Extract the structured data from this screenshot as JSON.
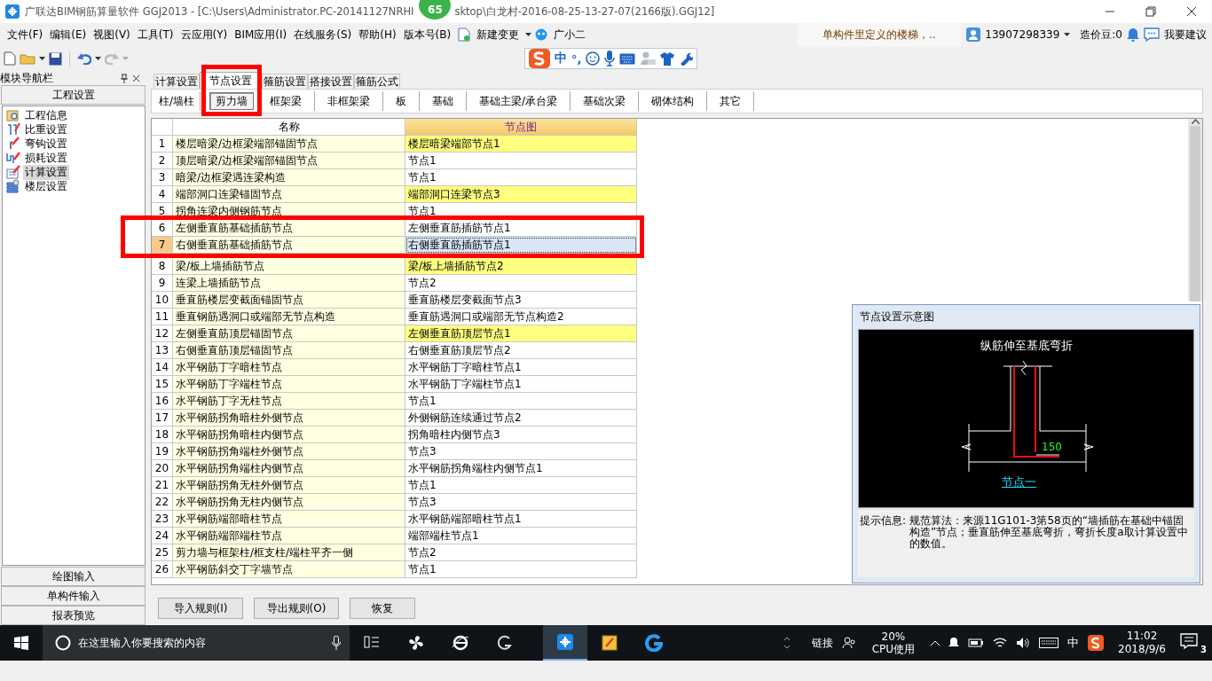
{
  "window": {
    "title_parts": [
      "广联达BIM钢筋算量软件 GGJ2013 - [C:\\Users\\Administrator.PC-20141127NRHI",
      "sktop\\白龙村-2016-08-25-13-27-07(2166版).GGJ12]"
    ],
    "badge": "65"
  },
  "menus": [
    "文件(F)",
    "编辑(E)",
    "视图(V)",
    "工具(T)",
    "云应用(Y)",
    "BIM应用(I)",
    "在线服务(S)",
    "帮助(H)",
    "版本号(B)"
  ],
  "menu_extras": {
    "change": "新建变更",
    "assistant": "广小二"
  },
  "header_right": {
    "notice": "单构件里定义的楼梯，..",
    "account": "13907298339",
    "beans": "造价豆:0",
    "suggest": "我要建议"
  },
  "ime": {
    "lang": "中",
    "punct": "°,"
  },
  "nav": {
    "title": "模块导航栏",
    "section": "工程设置",
    "items": [
      {
        "label": "工程信息",
        "selected": false
      },
      {
        "label": "比重设置",
        "selected": false
      },
      {
        "label": "弯钩设置",
        "selected": false
      },
      {
        "label": "损耗设置",
        "selected": false
      },
      {
        "label": "计算设置",
        "selected": true
      },
      {
        "label": "楼层设置",
        "selected": false
      }
    ],
    "bottom": [
      "绘图输入",
      "单构件输入",
      "报表预览"
    ]
  },
  "tabs": [
    {
      "label": "计算设置",
      "selected": false
    },
    {
      "label": "节点设置",
      "selected": true
    },
    {
      "label": "箍筋设置",
      "selected": false
    },
    {
      "label": "搭接设置",
      "selected": false
    },
    {
      "label": "箍筋公式",
      "selected": false
    }
  ],
  "subtabs": [
    {
      "label": "柱/墙柱",
      "selected": false
    },
    {
      "label": "剪力墙",
      "selected": true
    },
    {
      "label": "框架梁",
      "selected": false
    },
    {
      "label": "非框架梁",
      "selected": false
    },
    {
      "label": "板",
      "selected": false
    },
    {
      "label": "基础",
      "selected": false
    },
    {
      "label": "基础主梁/承台梁",
      "selected": false
    },
    {
      "label": "基础次梁",
      "selected": false
    },
    {
      "label": "砌体结构",
      "selected": false
    },
    {
      "label": "其它",
      "selected": false
    }
  ],
  "table": {
    "columns": [
      "名称",
      "节点图"
    ],
    "rows": [
      {
        "num": "1",
        "name": "楼层暗梁/边框梁端部锚固节点",
        "node": "楼层暗梁端部节点1",
        "highlighted": true,
        "selected": false
      },
      {
        "num": "2",
        "name": "顶层暗梁/边框梁端部锚固节点",
        "node": "节点1",
        "highlighted": false,
        "selected": false
      },
      {
        "num": "3",
        "name": "暗梁/边框梁遇连梁构造",
        "node": "节点1",
        "highlighted": false,
        "selected": false
      },
      {
        "num": "4",
        "name": "端部洞口连梁锚固节点",
        "node": "端部洞口连梁节点3",
        "highlighted": true,
        "selected": false
      },
      {
        "num": "5",
        "name": "拐角连梁内侧钢筋节点",
        "node": "节点1",
        "highlighted": false,
        "selected": false
      },
      {
        "num": "6",
        "name": "左侧垂直筋基础插筋节点",
        "node": "左侧垂直筋插筋节点1",
        "highlighted": false,
        "selected": false
      },
      {
        "num": "7",
        "name": "右侧垂直筋基础插筋节点",
        "node": "右侧垂直筋插筋节点1",
        "highlighted": false,
        "selected": true
      },
      {
        "num": "8",
        "name": "梁/板上墙插筋节点",
        "node": "梁/板上墙插筋节点2",
        "highlighted": true,
        "selected": false
      },
      {
        "num": "9",
        "name": "连梁上墙插筋节点",
        "node": "节点2",
        "highlighted": false,
        "selected": false
      },
      {
        "num": "10",
        "name": "垂直筋楼层变截面锚固节点",
        "node": "垂直筋楼层变截面节点3",
        "highlighted": false,
        "selected": false
      },
      {
        "num": "11",
        "name": "垂直钢筋遇洞口或端部无节点构造",
        "node": "垂直筋遇洞口或端部无节点构造2",
        "highlighted": false,
        "selected": false
      },
      {
        "num": "12",
        "name": "左侧垂直筋顶层锚固节点",
        "node": "左侧垂直筋顶层节点1",
        "highlighted": true,
        "selected": false
      },
      {
        "num": "13",
        "name": "右侧垂直筋顶层锚固节点",
        "node": "右侧垂直筋顶层节点2",
        "highlighted": false,
        "selected": false
      },
      {
        "num": "14",
        "name": "水平钢筋丁字暗柱节点",
        "node": "水平钢筋丁字暗柱节点1",
        "highlighted": false,
        "selected": false
      },
      {
        "num": "15",
        "name": "水平钢筋丁字端柱节点",
        "node": "水平钢筋丁字端柱节点1",
        "highlighted": false,
        "selected": false
      },
      {
        "num": "16",
        "name": "水平钢筋丁字无柱节点",
        "node": "节点1",
        "highlighted": false,
        "selected": false
      },
      {
        "num": "17",
        "name": "水平钢筋拐角暗柱外侧节点",
        "node": "外侧钢筋连续通过节点2",
        "highlighted": false,
        "selected": false
      },
      {
        "num": "18",
        "name": "水平钢筋拐角暗柱内侧节点",
        "node": "拐角暗柱内侧节点3",
        "highlighted": false,
        "selected": false
      },
      {
        "num": "19",
        "name": "水平钢筋拐角端柱外侧节点",
        "node": "节点3",
        "highlighted": false,
        "selected": false
      },
      {
        "num": "20",
        "name": "水平钢筋拐角端柱内侧节点",
        "node": "水平钢筋拐角端柱内侧节点1",
        "highlighted": false,
        "selected": false
      },
      {
        "num": "21",
        "name": "水平钢筋拐角无柱外侧节点",
        "node": "节点1",
        "highlighted": false,
        "selected": false
      },
      {
        "num": "22",
        "name": "水平钢筋拐角无柱内侧节点",
        "node": "节点3",
        "highlighted": false,
        "selected": false
      },
      {
        "num": "23",
        "name": "水平钢筋端部暗柱节点",
        "node": "水平钢筋端部暗柱节点1",
        "highlighted": false,
        "selected": false
      },
      {
        "num": "24",
        "name": "水平钢筋端部端柱节点",
        "node": "端部端柱节点1",
        "highlighted": false,
        "selected": false
      },
      {
        "num": "25",
        "name": "剪力墙与框架柱/框支柱/端柱平齐一侧",
        "node": "节点2",
        "highlighted": false,
        "selected": false
      },
      {
        "num": "26",
        "name": "水平钢筋斜交丁字墙节点",
        "node": "节点1",
        "highlighted": false,
        "selected": false
      }
    ]
  },
  "buttons": [
    "导入规则(I)",
    "导出规则(O)",
    "恢复"
  ],
  "popup": {
    "title": "节点设置示意图",
    "diagram_label": "纵筋伸至基底弯折",
    "dimension": "150",
    "link": "节点一",
    "hint_label": "提示信息:",
    "hint": "规范算法：来源11G101-3第58页的“墙插筋在基础中锚固构造”节点；垂直筋伸至基底弯折，弯折长度a取计算设置中的数值。"
  },
  "taskbar": {
    "search_placeholder": "在这里输入你要搜索的内容",
    "links": "链接",
    "cpu_percent": "20%",
    "cpu_label": "CPU使用",
    "ime": "中",
    "time": "11:02",
    "date": "2018/9/6",
    "notifications": "3"
  }
}
